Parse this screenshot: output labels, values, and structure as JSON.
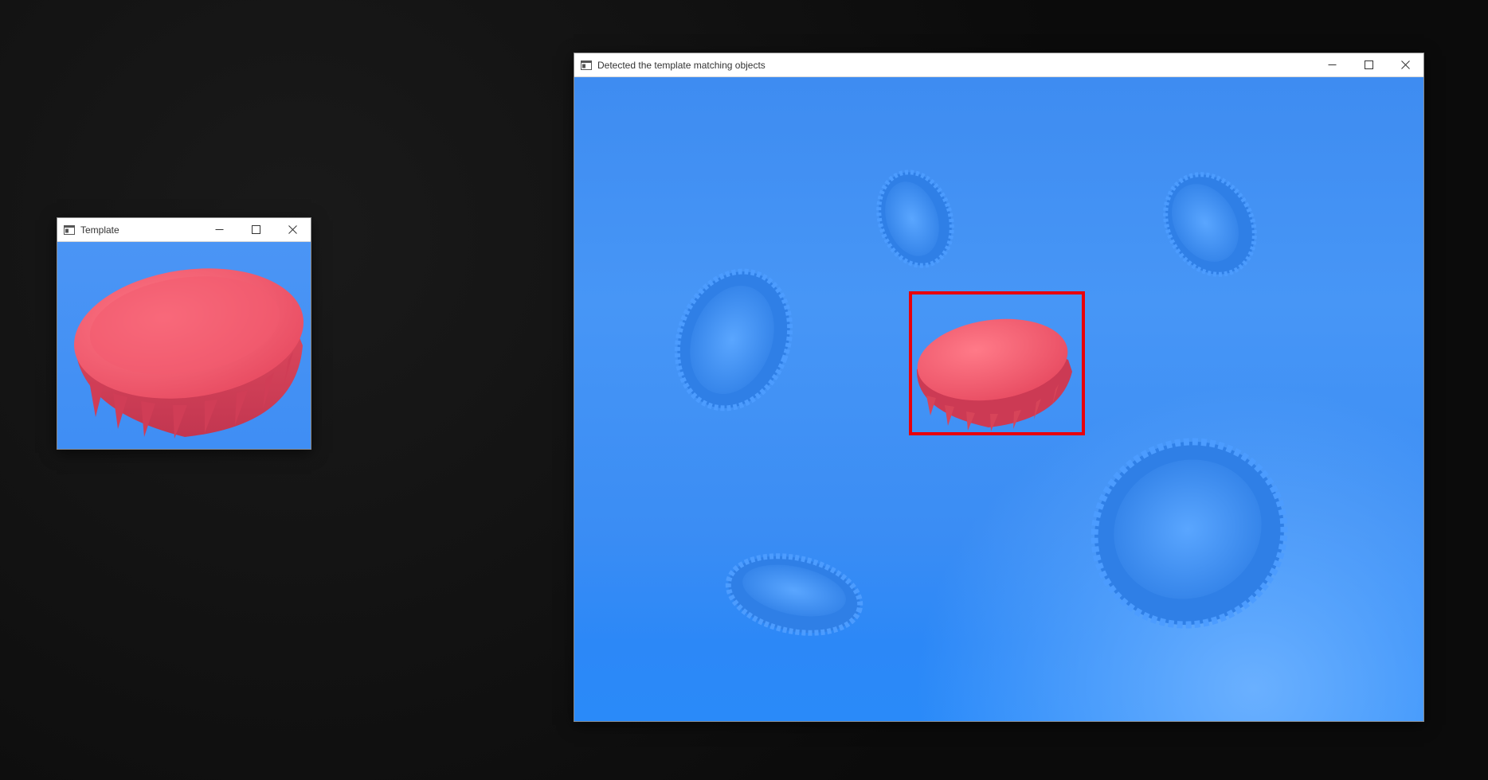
{
  "windows": {
    "template": {
      "title": "Template",
      "controls": [
        "minimize",
        "maximize",
        "close"
      ],
      "cap_color": "#f0576b",
      "background_color": "#4b95f5"
    },
    "detected": {
      "title": "Detected the template matching objects",
      "controls": [
        "minimize",
        "maximize",
        "close"
      ],
      "background_color": "#3e8cf1",
      "box_color": "#e8000b",
      "cap_color_target": "#f0576b",
      "cap_color_other": "#3d8ef2"
    }
  },
  "icons": {
    "window_icon": "window-app-icon",
    "minimize": "minimize-icon",
    "maximize": "maximize-icon",
    "close": "close-icon"
  }
}
